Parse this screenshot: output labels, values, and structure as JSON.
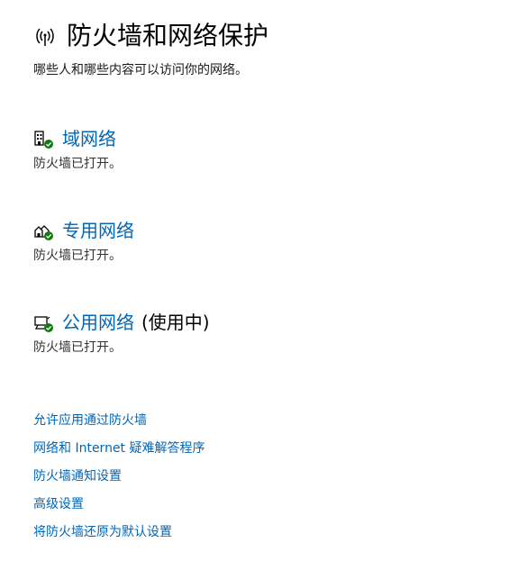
{
  "header": {
    "title": "防火墙和网络保护",
    "icon": "antenna-icon",
    "subtitle": "哪些人和哪些内容可以访问你的网络。"
  },
  "networks": [
    {
      "name": "域网络",
      "icon": "domain-network-icon",
      "status": "防火墙已打开。",
      "in_use": ""
    },
    {
      "name": "专用网络",
      "icon": "private-network-icon",
      "status": "防火墙已打开。",
      "in_use": ""
    },
    {
      "name": "公用网络",
      "icon": "public-network-icon",
      "status": "防火墙已打开。",
      "in_use": "(使用中)"
    }
  ],
  "links": [
    "允许应用通过防火墙",
    "网络和 Internet 疑难解答程序",
    "防火墙通知设置",
    "高级设置",
    "将防火墙还原为默认设置"
  ],
  "colors": {
    "link": "#0067b8",
    "check": "#107c10",
    "text": "#000000",
    "muted": "#333333"
  }
}
